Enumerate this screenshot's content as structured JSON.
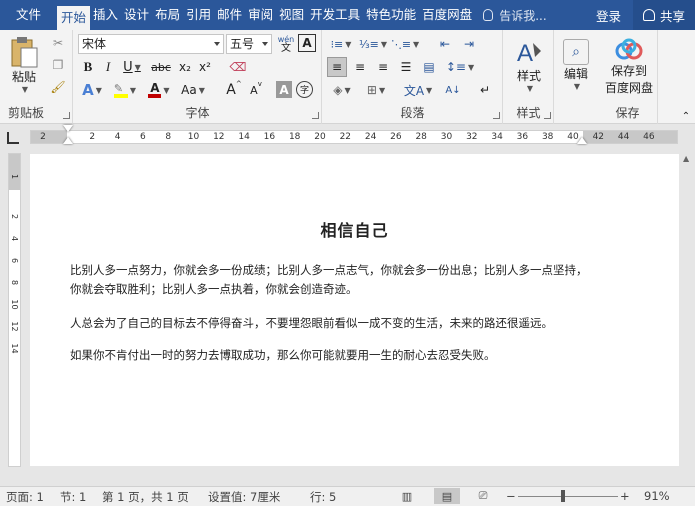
{
  "tabs": {
    "file": "文件",
    "home": "开始",
    "insert": "插入",
    "design": "设计",
    "layout": "布局",
    "references": "引用",
    "mailings": "邮件",
    "review": "审阅",
    "view": "视图",
    "developer": "开发工具",
    "special": "特色功能",
    "baidu": "百度网盘"
  },
  "tell_me": "告诉我...",
  "login": "登录",
  "share": "共享",
  "clipboard": {
    "paste": "粘贴",
    "label": "剪贴板"
  },
  "font": {
    "name": "宋体",
    "size": "五号",
    "label": "字体",
    "bold": "B",
    "italic": "I",
    "underline": "U",
    "strike": "abc",
    "subscript": "x₂",
    "superscript": "x²",
    "case": "Aa",
    "grow": "A",
    "shrink": "A",
    "phonetic": "wén",
    "border_char": "A",
    "shade_char": "A",
    "circle_char": "字"
  },
  "paragraph": {
    "label": "段落"
  },
  "styles": {
    "button": "样式",
    "label": "样式"
  },
  "editing": {
    "button": "编辑"
  },
  "save": {
    "button_line1": "保存到",
    "button_line2": "百度网盘",
    "label": "保存"
  },
  "ruler": {
    "ticks": [
      "2",
      "2",
      "4",
      "6",
      "8",
      "10",
      "12",
      "14",
      "16",
      "18",
      "20",
      "22",
      "24",
      "26",
      "28",
      "30",
      "32",
      "34",
      "36",
      "38",
      "40",
      "42",
      "44",
      "46"
    ]
  },
  "vruler": {
    "ticks": [
      "1",
      "2",
      "4",
      "6",
      "8",
      "10",
      "12",
      "14"
    ]
  },
  "document": {
    "title": "相信自己",
    "p1": "比别人多一点努力，你就会多一份成绩；比别人多一点志气，你就会多一份出息；比别人多一点坚持，你就会夺取胜利；比别人多一点执着，你就会创造奇迹。",
    "p2": "人总会为了自己的目标去不停得奋斗，不要埋怨眼前看似一成不变的生活，未来的路还很遥远。",
    "p3": "如果你不肯付出一时的努力去博取成功，那么你可能就要用一生的耐心去忍受失败。"
  },
  "status": {
    "page": "页面: 1",
    "section": "节: 1",
    "pages": "第 1 页，共 1 页",
    "setting": "设置值: 7厘米",
    "line": "行: 5",
    "zoom": "91%",
    "minus": "−",
    "plus": "+"
  },
  "colors": {
    "accent": "#2b579a",
    "highlight": "#ffff00",
    "font_color": "#c00000"
  }
}
